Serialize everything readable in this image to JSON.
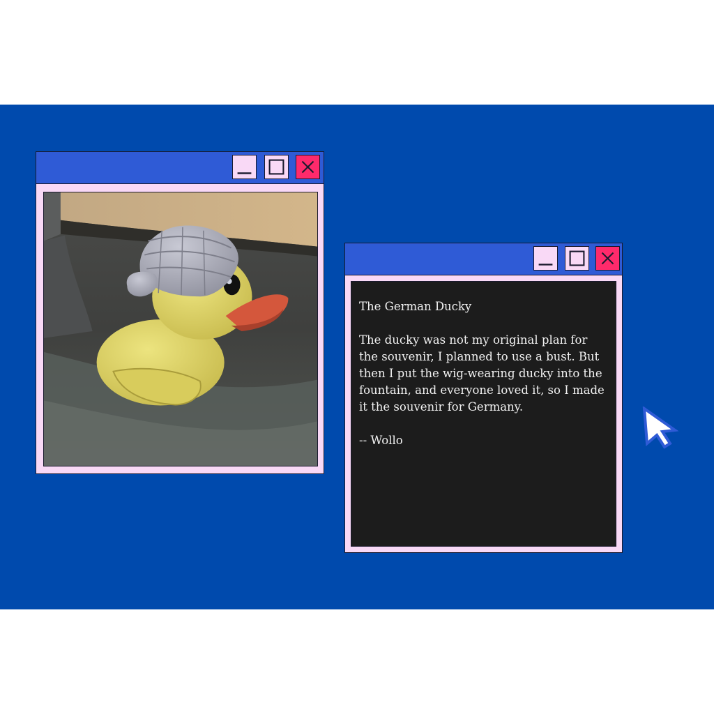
{
  "photo_window": {
    "buttons": {
      "minimize_icon": "minimize-icon",
      "maximize_icon": "maximize-icon",
      "close_icon": "close-icon"
    }
  },
  "text_window": {
    "title": "The German Ducky",
    "body": "The ducky was not my original plan for the souvenir, I planned to use a bust. But then I put the wig-wearing ducky into the fountain, and everyone loved it, so I made it the souvenir for Germany.",
    "signature": "-- Wollo"
  },
  "colors": {
    "desktop": "#004aad",
    "titlebar": "#2f5bd6",
    "window_frame": "#f9d9f6",
    "close_button": "#ff2a6b",
    "text_panel": "#1c1c1c"
  },
  "cursor": {
    "icon": "arrow-cursor-icon"
  }
}
